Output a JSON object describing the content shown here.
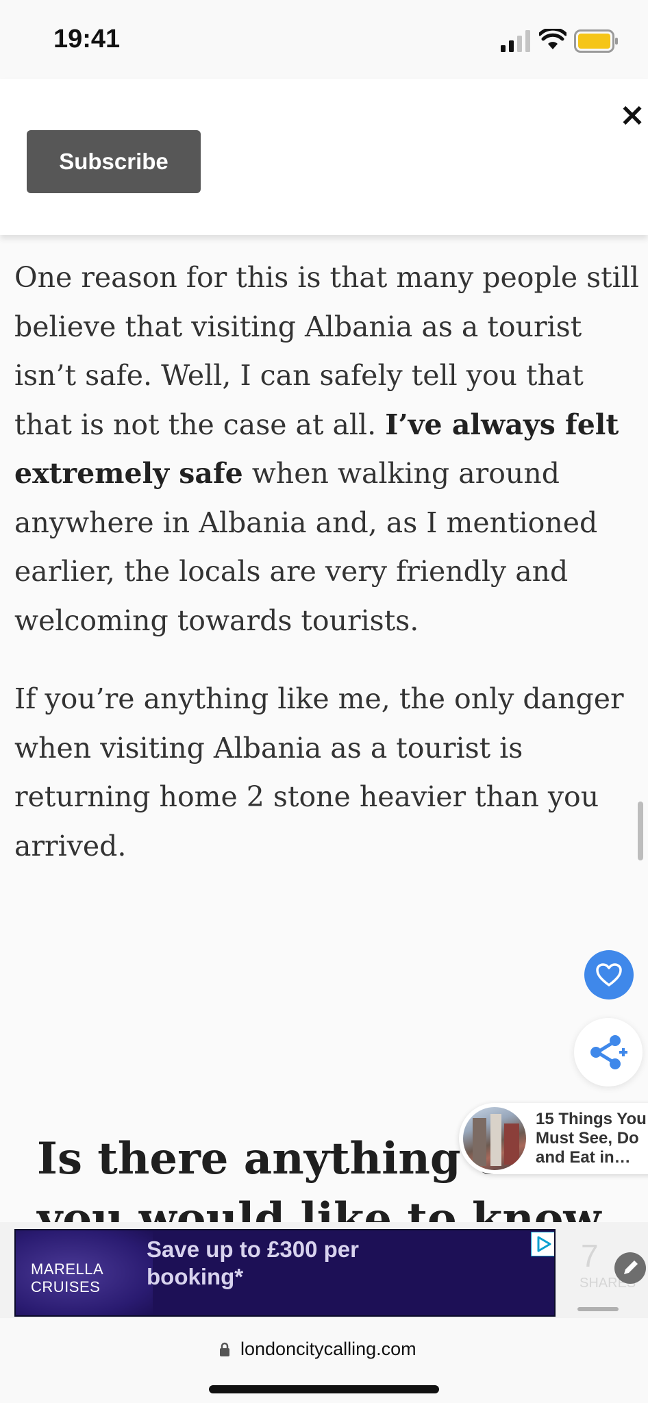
{
  "status_bar": {
    "time": "19:41"
  },
  "subscribe_bar": {
    "subscribe_label": "Subscribe",
    "close_label": "×"
  },
  "article": {
    "paragraph1": {
      "before_bold": "One reason for this is that many people still believe that visiting Albania as a tourist isn’t safe. Well, I can safely tell you that that is not the case at all. ",
      "bold": "I’ve always felt extremely safe",
      "after_bold": " when walking around anywhere in Albania and, as I mentioned earlier, the locals are very friendly and welcoming towards tourists."
    },
    "paragraph2": "If you’re anything like me, the only danger when visiting Albania as a tourist is returning home 2 stone heavier than you arrived."
  },
  "related_article": {
    "title": "15 Things You\nMust See, Do\nand Eat in…"
  },
  "section_heading": "Is there anything else you would like to know about",
  "ad": {
    "brand": "MARELLA\nCRUISES",
    "headline": "Save up to £300 per\nbooking*"
  },
  "share_widget": {
    "count": "7",
    "label": "SHARES"
  },
  "browser": {
    "url": "londoncitycalling.com"
  },
  "colors": {
    "accent_blue": "#3f88ea",
    "ad_background": "#1d1056",
    "subscribe_button": "#575757"
  }
}
